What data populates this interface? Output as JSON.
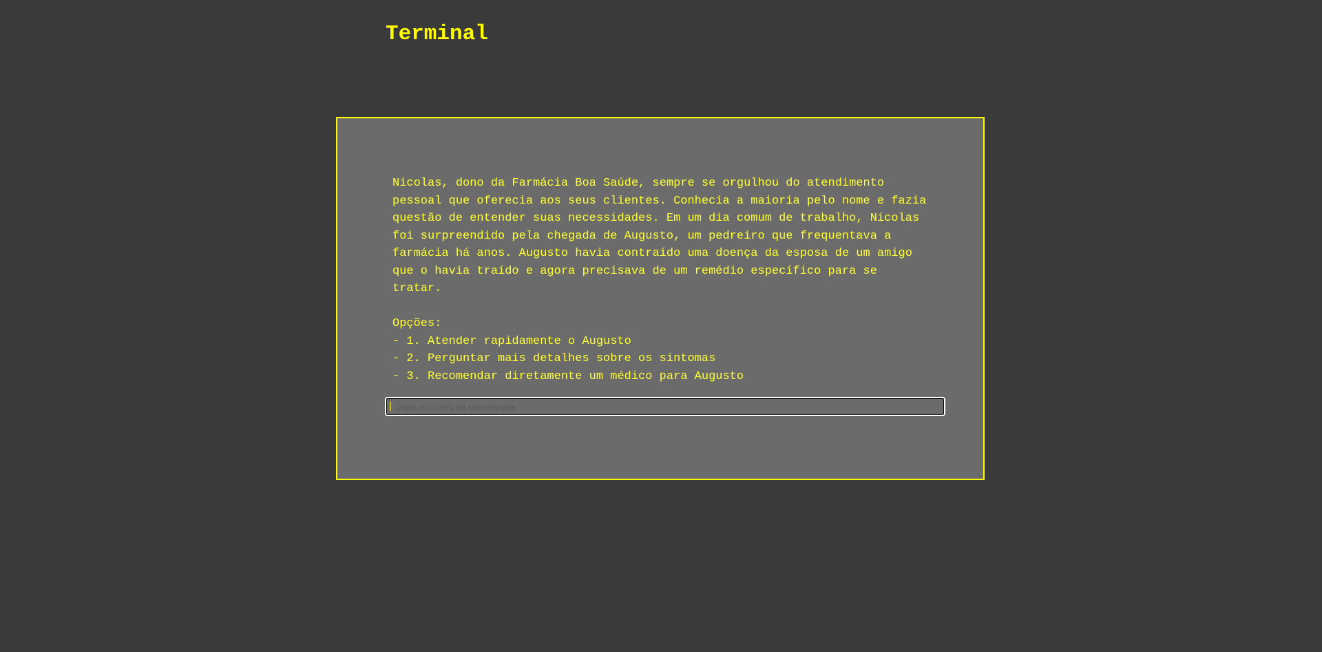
{
  "header": {
    "title": "Terminal"
  },
  "terminal": {
    "story": "Nicolas, dono da Farmácia Boa Saúde, sempre se orgulhou do atendimento\npessoal que oferecia aos seus clientes. Conhecia a maioria pelo nome e fazia\nquestão de entender suas necessidades. Em um dia comum de trabalho, Nicolas\nfoi surpreendido pela chegada de Augusto, um pedreiro que frequentava a\nfarmácia há anos. Augusto havia contraído uma doença da esposa de um amigo\nque o havia traído e agora precisava de um remédio específico para se\ntratar.",
    "options_heading": "Opções:",
    "options": [
      "- 1. Atender rapidamente o Augusto",
      "- 2. Perguntar mais detalhes sobre os sintomas",
      "- 3. Recomendar diretamente um médico para Augusto"
    ],
    "input": {
      "value": "",
      "placeholder": "Digite o número da sua resposta"
    }
  },
  "colors": {
    "background": "#3a3a3a",
    "panel": "#6b6b6b",
    "accent": "#ffff00"
  }
}
